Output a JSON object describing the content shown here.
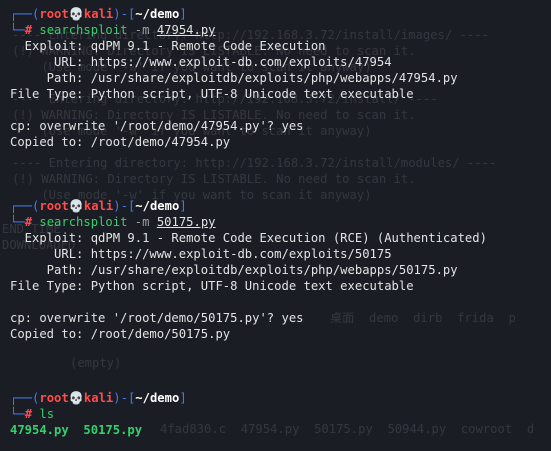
{
  "ghost": {
    "lines": [
      "---- Entering directory: http://192.168.3.72/install/images/ ----",
      "(!) WARNING: Directory IS LISTABLE. No need to scan it.",
      "    (Use mode '-w' if you want to scan it anyway)",
      "---- Entering directory: http://192.168.3.72/install/ ----",
      "(!) WARNING: Directory IS LISTABLE. No need to scan it.",
      "    (Use mode '-w' if you want to scan it anyway)",
      "---- Entering directory: http://192.168.3.72/install/modules/ ----",
      "(!) WARNING: Directory IS LISTABLE. No need to scan it.",
      "    (Use mode '-w' if you want to scan it anyway)",
      "END_TIME",
      "DOWNLOADED",
      "桌面  demo  dirb  frida  p",
      "(empty)",
      "4fad830.c  47954.py  50175.py  50944.py  cowroot  d"
    ]
  },
  "prompt": {
    "open": "┌──(",
    "user": "root",
    "skull": "💀",
    "host": "kali",
    "mid": ")-[",
    "dir": "~/demo",
    "close": "]",
    "corner": "└─",
    "hash": "#"
  },
  "blocks": [
    {
      "command": "searchsploit",
      "flag": "-m",
      "arg": "47954.py",
      "output": [
        "  Exploit: qdPM 9.1 - Remote Code Execution",
        "      URL: https://www.exploit-db.com/exploits/47954",
        "     Path: /usr/share/exploitdb/exploits/php/webapps/47954.py",
        "File Type: Python script, UTF-8 Unicode text executable",
        "",
        "cp: overwrite '/root/demo/47954.py'? yes",
        "Copied to: /root/demo/47954.py"
      ]
    },
    {
      "command": "searchsploit",
      "flag": "-m",
      "arg": "50175.py",
      "output": [
        "  Exploit: qdPM 9.1 - Remote Code Execution (RCE) (Authenticated)",
        "      URL: https://www.exploit-db.com/exploits/50175",
        "     Path: /usr/share/exploitdb/exploits/php/webapps/50175.py",
        "File Type: Python script, UTF-8 Unicode text executable",
        "",
        "cp: overwrite '/root/demo/50175.py'? yes",
        "Copied to: /root/demo/50175.py"
      ]
    }
  ],
  "ls_block": {
    "command": "ls",
    "files": [
      "47954.py",
      "50175.py"
    ]
  }
}
